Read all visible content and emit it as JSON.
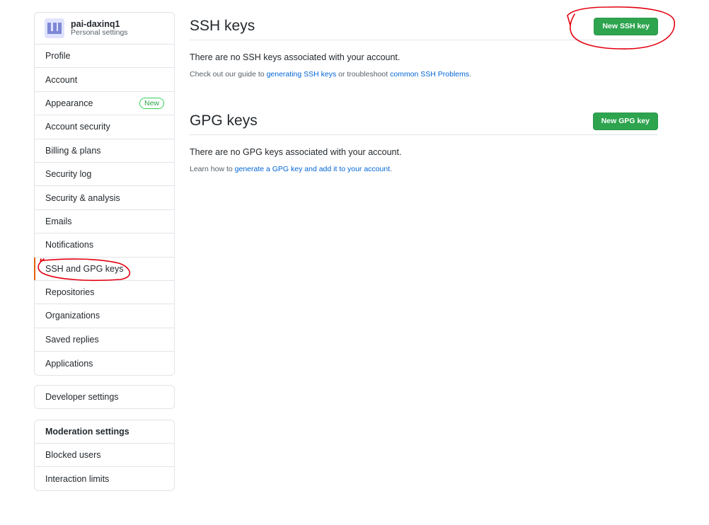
{
  "user": {
    "name": "pai-daxinq1",
    "subtitle": "Personal settings"
  },
  "sidebar": {
    "items": [
      {
        "label": "Profile"
      },
      {
        "label": "Account"
      },
      {
        "label": "Appearance",
        "badge": "New"
      },
      {
        "label": "Account security"
      },
      {
        "label": "Billing & plans"
      },
      {
        "label": "Security log"
      },
      {
        "label": "Security & analysis"
      },
      {
        "label": "Emails"
      },
      {
        "label": "Notifications"
      },
      {
        "label": "SSH and GPG keys",
        "selected": true
      },
      {
        "label": "Repositories"
      },
      {
        "label": "Organizations"
      },
      {
        "label": "Saved replies"
      },
      {
        "label": "Applications"
      }
    ],
    "developer": "Developer settings",
    "moderation": {
      "heading": "Moderation settings",
      "items": [
        "Blocked users",
        "Interaction limits"
      ]
    }
  },
  "ssh": {
    "title": "SSH keys",
    "button": "New SSH key",
    "empty": "There are no SSH keys associated with your account.",
    "note_prefix": "Check out our guide to ",
    "note_link1": "generating SSH keys",
    "note_mid": " or troubleshoot ",
    "note_link2": "common SSH Problems",
    "note_suffix": "."
  },
  "gpg": {
    "title": "GPG keys",
    "button": "New GPG key",
    "empty": "There are no GPG keys associated with your account.",
    "note_prefix": "Learn how to ",
    "note_link": "generate a GPG key and add it to your account",
    "note_suffix": "."
  },
  "colors": {
    "accent_green": "#2ea44f",
    "link_blue": "#0366d6",
    "annotation_red": "#e3000f",
    "selected_bar": "#e36209"
  }
}
